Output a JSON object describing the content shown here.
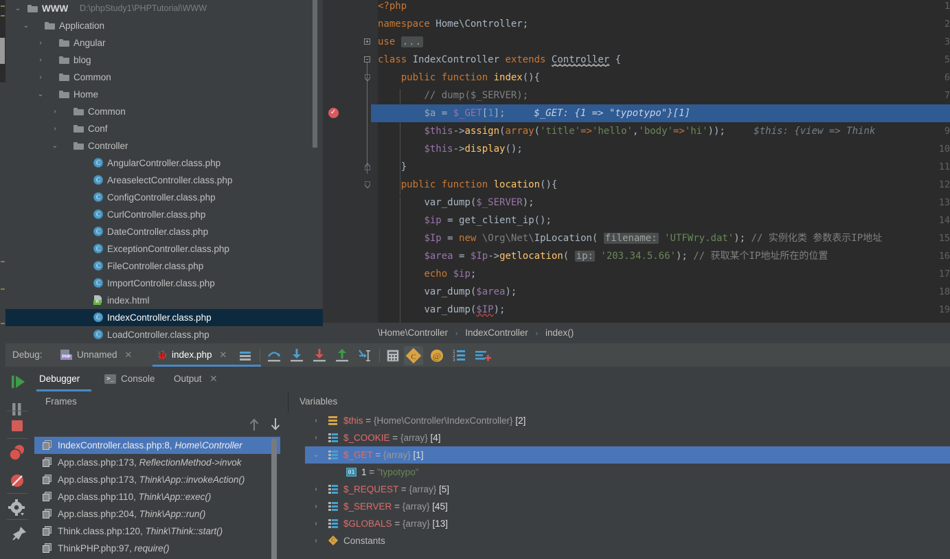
{
  "project_tree": {
    "root_label": "WWW",
    "root_path": "D:\\phpStudy1\\PHPTutorial\\WWW",
    "items": [
      {
        "label": "Application",
        "type": "folder",
        "depth": 1,
        "expanded": true
      },
      {
        "label": "Angular",
        "type": "folder",
        "depth": 2,
        "expanded": false
      },
      {
        "label": "blog",
        "type": "folder",
        "depth": 2,
        "expanded": false
      },
      {
        "label": "Common",
        "type": "folder",
        "depth": 2,
        "expanded": false
      },
      {
        "label": "Home",
        "type": "folder",
        "depth": 2,
        "expanded": true
      },
      {
        "label": "Common",
        "type": "folder",
        "depth": 3,
        "expanded": false
      },
      {
        "label": "Conf",
        "type": "folder",
        "depth": 3,
        "expanded": false
      },
      {
        "label": "Controller",
        "type": "folder",
        "depth": 3,
        "expanded": true
      },
      {
        "label": "AngularController.class.php",
        "type": "php",
        "depth": 4
      },
      {
        "label": "AreaselectController.class.php",
        "type": "php",
        "depth": 4
      },
      {
        "label": "ConfigController.class.php",
        "type": "php",
        "depth": 4
      },
      {
        "label": "CurlController.class.php",
        "type": "php",
        "depth": 4
      },
      {
        "label": "DateController.class.php",
        "type": "php",
        "depth": 4
      },
      {
        "label": "ExceptionController.class.php",
        "type": "php",
        "depth": 4
      },
      {
        "label": "FileController.class.php",
        "type": "php",
        "depth": 4
      },
      {
        "label": "ImportController.class.php",
        "type": "php",
        "depth": 4
      },
      {
        "label": "index.html",
        "type": "html",
        "depth": 4
      },
      {
        "label": "IndexController.class.php",
        "type": "php",
        "depth": 4,
        "selected": true
      },
      {
        "label": "LoadController.class.php",
        "type": "php",
        "depth": 4
      }
    ]
  },
  "editor": {
    "lines": [
      {
        "no": "1",
        "text": "<?php"
      },
      {
        "no": "2",
        "text": "namespace Home\\Controller;"
      },
      {
        "no": "3",
        "text": "use ..."
      },
      {
        "no": "5",
        "text": "class IndexController extends Controller {"
      },
      {
        "no": "6",
        "text": "    public function index(){"
      },
      {
        "no": "7",
        "text": "        // dump($_SERVER);"
      },
      {
        "no": "8",
        "text": "        $a = $_GET[1];",
        "inline_hint": "$_GET: {1 => \"typotypo\"}[1]",
        "highlighted": true,
        "breakpoint": true
      },
      {
        "no": "9",
        "text": "        $this->assign(array('title'=>'hello','body'=>'hi'));",
        "inline_hint": "$this: {view => Think"
      },
      {
        "no": "10",
        "text": "        $this->display();"
      },
      {
        "no": "11",
        "text": "    }"
      },
      {
        "no": "12",
        "text": "    public function location(){"
      },
      {
        "no": "13",
        "text": "        var_dump($_SERVER);"
      },
      {
        "no": "14",
        "text": "        $ip = get_client_ip();"
      },
      {
        "no": "15",
        "text": "        $Ip = new \\Org\\Net\\IpLocation( filename: 'UTFWry.dat'); // 实例化类 参数表示IP地址"
      },
      {
        "no": "16",
        "text": "        $area = $Ip->getlocation( ip: '203.34.5.66'); // 获取某个IP地址所在的位置"
      },
      {
        "no": "17",
        "text": "        echo $ip;"
      },
      {
        "no": "18",
        "text": "        var_dump($area);"
      },
      {
        "no": "19",
        "text": "        var_dump($IP);"
      }
    ],
    "param_hint_filename": "filename:",
    "param_hint_ip": "ip:",
    "comment_15": "// 实例化类 参数表示IP地址",
    "comment_16": "// 获取某个IP地址所在的位置"
  },
  "breadcrumb": {
    "items": [
      "\\Home\\Controller",
      "IndexController",
      "index()"
    ],
    "separator": "›"
  },
  "debug_panel": {
    "title": "Debug:",
    "session_tabs": [
      {
        "label": "Unnamed",
        "icon": "php-file-icon",
        "active": false,
        "close": "✕"
      },
      {
        "label": "index.php",
        "icon": "bug-icon",
        "active": true,
        "close": "✕"
      }
    ],
    "view_tabs": [
      {
        "label": "Debugger",
        "active": true
      },
      {
        "label": "Console",
        "active": false,
        "icon": "console-icon"
      },
      {
        "label": "Output",
        "active": false,
        "close": "✕"
      }
    ],
    "toolbar_icons": [
      "mute-breakpoints-icon",
      "step-over-icon",
      "step-into-icon",
      "force-step-into-icon",
      "step-out-icon",
      "run-to-cursor-icon",
      "evaluate-expression-icon",
      "show-constants-icon",
      "show-static-icon",
      "show-values-inline-icon",
      "add-watch-icon"
    ],
    "side_buttons": [
      "resume-program-icon",
      "pause-program-icon",
      "stop-icon",
      "view-breakpoints-icon",
      "mute-breakpoints-icon",
      "settings-icon",
      "pin-icon"
    ],
    "frames": {
      "header": "Frames",
      "toolbar_icons": [
        "arrow-up-icon",
        "arrow-down-icon"
      ],
      "rows": [
        {
          "file": "IndexController.class.php:8,",
          "ctx": "Home\\Controller",
          "selected": true
        },
        {
          "file": "App.class.php:173,",
          "ctx": "ReflectionMethod->invok"
        },
        {
          "file": "App.class.php:173,",
          "ctx": "Think\\App::invokeAction()"
        },
        {
          "file": "App.class.php:110,",
          "ctx": "Think\\App::exec()"
        },
        {
          "file": "App.class.php:204,",
          "ctx": "Think\\App::run()"
        },
        {
          "file": "Think.class.php:120,",
          "ctx": "Think\\Think::start()"
        },
        {
          "file": "ThinkPHP.php:97,",
          "ctx": "require()"
        }
      ]
    },
    "variables": {
      "header": "Variables",
      "toolbar_icons": [
        "plus-icon",
        "minus-icon",
        "up-icon",
        "down-icon",
        "copy-icon",
        "watches-icon"
      ],
      "rows": [
        {
          "indent": 0,
          "arrow": "›",
          "icon": "object-icon",
          "name": "$this",
          "eq": "=",
          "type": "{Home\\Controller\\IndexController}",
          "count": "[2]"
        },
        {
          "indent": 0,
          "arrow": "›",
          "icon": "array-icon",
          "name": "$_COOKIE",
          "eq": "=",
          "type": "{array}",
          "count": "[4]"
        },
        {
          "indent": 0,
          "arrow": "⌄",
          "icon": "array-icon",
          "name": "$_GET",
          "eq": "=",
          "type": "{array}",
          "count": "[1]",
          "selected": true
        },
        {
          "indent": 1,
          "arrow": "",
          "icon": "number-icon",
          "name": "1",
          "eq": "=",
          "value": "\"typotypo\""
        },
        {
          "indent": 0,
          "arrow": "›",
          "icon": "array-icon",
          "name": "$_REQUEST",
          "eq": "=",
          "type": "{array}",
          "count": "[5]"
        },
        {
          "indent": 0,
          "arrow": "›",
          "icon": "array-icon",
          "name": "$_SERVER",
          "eq": "=",
          "type": "{array}",
          "count": "[45]"
        },
        {
          "indent": 0,
          "arrow": "›",
          "icon": "array-icon",
          "name": "$GLOBALS",
          "eq": "=",
          "type": "{array}",
          "count": "[13]"
        },
        {
          "indent": 0,
          "arrow": "›",
          "icon": "constants-icon",
          "name": "Constants",
          "plain": true
        }
      ]
    }
  },
  "colors": {
    "accent_blue": "#4a88c7",
    "selection_blue": "#2f5a92",
    "tree_selection": "#0d293e",
    "editor_bg": "#2b2b2b",
    "panel_bg": "#3c3f41",
    "breakpoint_red": "#db5860"
  }
}
